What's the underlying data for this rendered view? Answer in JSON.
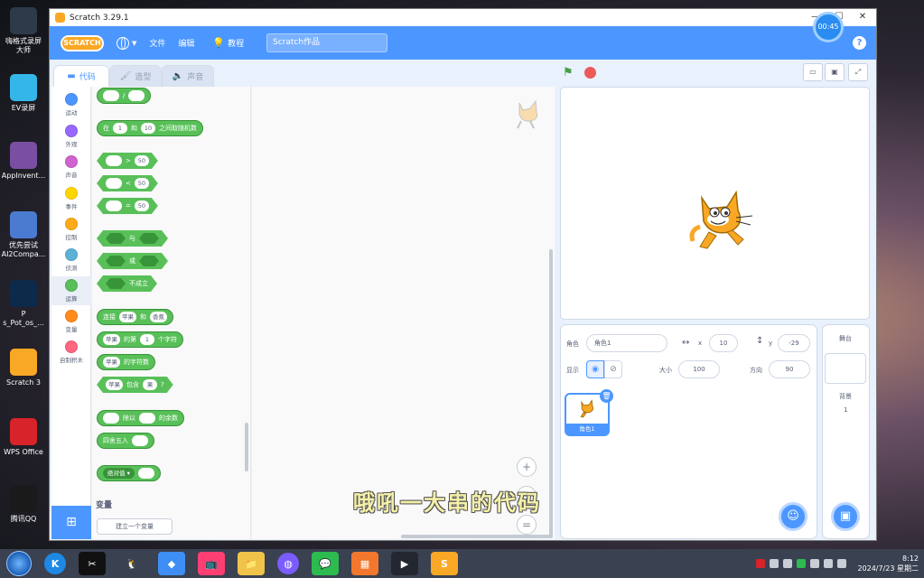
{
  "desktop": {
    "icons": [
      {
        "label": "嗨格式录屏\n大师",
        "icon": "video-camera-icon",
        "color": "#2d3a4a"
      },
      {
        "label": "EV录屏",
        "icon": "ev-logo-icon",
        "color": "#35b6e8"
      },
      {
        "label": "AppInvent...",
        "icon": "archive-icon",
        "color": "#7a4ea3"
      },
      {
        "label": "优先尝试\nAI2Compa...",
        "icon": "archive-icon",
        "color": "#4a7bd0"
      },
      {
        "label": "P\ns_Pot_os_...",
        "icon": "photoshop-icon",
        "color": "#0c2a4a"
      },
      {
        "label": "Scratch 3",
        "icon": "scratch-icon",
        "color": "#f9a825"
      },
      {
        "label": "WPS Office",
        "icon": "wps-icon",
        "color": "#d8232a"
      },
      {
        "label": "腾讯QQ",
        "icon": "qq-penguin-icon",
        "color": "#1a1a1a"
      }
    ]
  },
  "window": {
    "title": "Scratch 3.29.1",
    "controls": {
      "minimize": "—",
      "maximize": "☐",
      "close": "✕"
    }
  },
  "menubar": {
    "logo": "SCRATCH",
    "file": "文件",
    "edit": "编辑",
    "tutorials": "教程",
    "project_title": "Scratch作品",
    "help": "?"
  },
  "tabs": {
    "code": "代码",
    "costumes": "造型",
    "sounds": "声音"
  },
  "categories": [
    {
      "label": "运动",
      "color": "#4c97ff"
    },
    {
      "label": "外观",
      "color": "#9966ff"
    },
    {
      "label": "声音",
      "color": "#cf63cf"
    },
    {
      "label": "事件",
      "color": "#ffd500"
    },
    {
      "label": "控制",
      "color": "#ffab19"
    },
    {
      "label": "侦测",
      "color": "#5cb1d6"
    },
    {
      "label": "运算",
      "color": "#59c059"
    },
    {
      "label": "变量",
      "color": "#ff8c1a"
    },
    {
      "label": "自制积木",
      "color": "#ff6680"
    }
  ],
  "blocks": {
    "divide": "/",
    "random": {
      "pre": "在",
      "a": "1",
      "mid": "和",
      "b": "10",
      "post": "之间取随机数"
    },
    "gt": {
      "op": ">",
      "v": "50"
    },
    "lt": {
      "op": "<",
      "v": "50"
    },
    "eq": {
      "op": "=",
      "v": "50"
    },
    "and": "与",
    "or": "或",
    "not": "不成立",
    "join": {
      "pre": "连接",
      "a": "苹果",
      "mid": "和",
      "b": "香蕉"
    },
    "letter": {
      "a": "苹果",
      "mid": "的第",
      "n": "1",
      "post": "个字符"
    },
    "length": {
      "a": "苹果",
      "post": "的字符数"
    },
    "contains": {
      "a": "苹果",
      "mid": "包含",
      "b": "果",
      "post": "?"
    },
    "mod": {
      "mid": "除以",
      "post": "的余数"
    },
    "round": "四舍五入",
    "abs": "绝对值"
  },
  "variables": {
    "heading": "变量",
    "make_button": "建立一个变量"
  },
  "zoom": {
    "in": "+",
    "out": "−",
    "reset": "="
  },
  "sprite_info": {
    "sprite_label": "角色",
    "sprite_name": "角色1",
    "x_label": "x",
    "x_value": "10",
    "y_label": "y",
    "y_value": "-29",
    "show_label": "显示",
    "size_label": "大小",
    "size_value": "100",
    "direction_label": "方向",
    "direction_value": "90"
  },
  "sprite_thumb": {
    "name": "角色1"
  },
  "stage_panel": {
    "heading": "舞台",
    "backdrops_label": "背景",
    "backdrops_count": "1"
  },
  "timer": "00:45",
  "subtitle": "哦吼一大串的代码",
  "taskbar": {
    "time": "8:12",
    "date": "2024/7/23 星期二"
  }
}
